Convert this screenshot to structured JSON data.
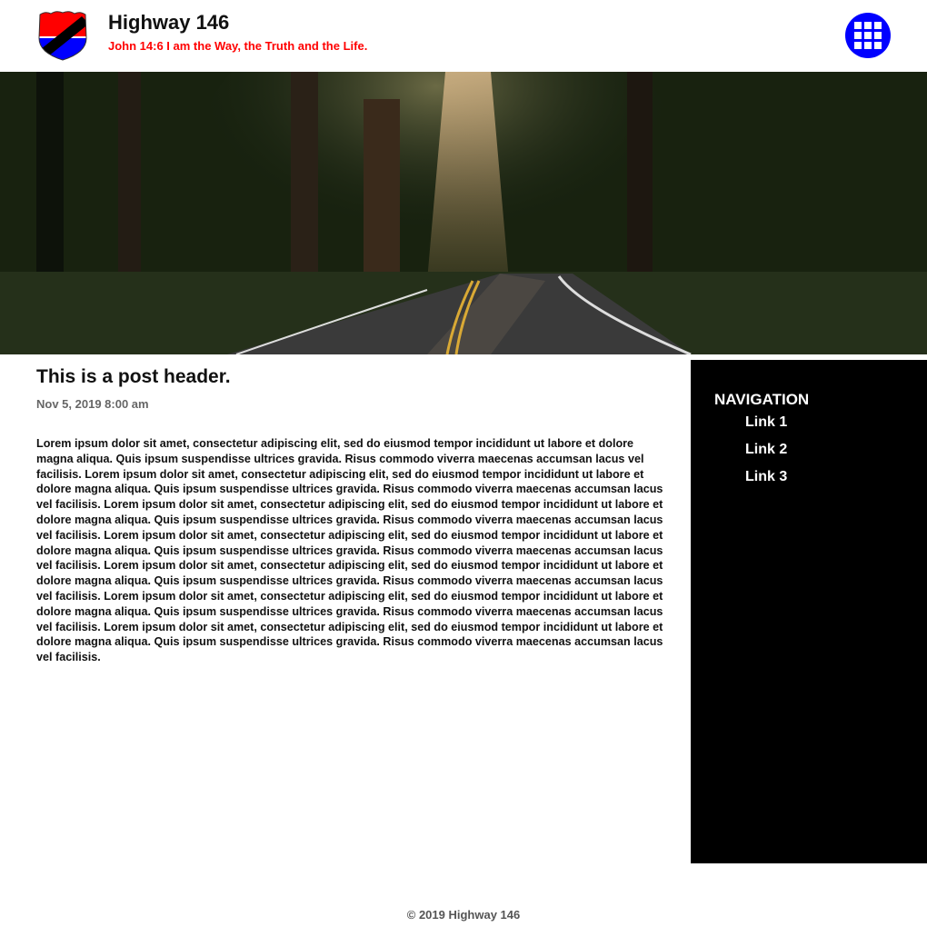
{
  "header": {
    "title": "Highway 146",
    "tagline": "John 14:6 I am the Way, the Truth and the Life.",
    "logo_icon": "highway-shield-icon",
    "menu_icon": "grid-menu-icon",
    "accent": "#0000ff",
    "tagline_color": "#ff0000"
  },
  "post": {
    "title": "This is a post header.",
    "date": "Nov 5, 2019 8:00 am",
    "body": "Lorem ipsum dolor sit amet, consectetur adipiscing elit, sed do eiusmod tempor incididunt ut labore et dolore magna aliqua. Quis ipsum suspendisse ultrices gravida. Risus commodo viverra maecenas accumsan lacus vel facilisis. Lorem ipsum dolor sit amet, consectetur adipiscing elit, sed do eiusmod tempor incididunt ut labore et dolore magna aliqua. Quis ipsum suspendisse ultrices gravida. Risus commodo viverra maecenas accumsan lacus vel facilisis. Lorem ipsum dolor sit amet, consectetur adipiscing elit, sed do eiusmod tempor incididunt ut labore et dolore magna aliqua. Quis ipsum suspendisse ultrices gravida. Risus commodo viverra maecenas accumsan lacus vel facilisis. Lorem ipsum dolor sit amet, consectetur adipiscing elit, sed do eiusmod tempor incididunt ut labore et dolore magna aliqua. Quis ipsum suspendisse ultrices gravida. Risus commodo viverra maecenas accumsan lacus vel facilisis. Lorem ipsum dolor sit amet, consectetur adipiscing elit, sed do eiusmod tempor incididunt ut labore et dolore magna aliqua. Quis ipsum suspendisse ultrices gravida. Risus commodo viverra maecenas accumsan lacus vel facilisis. Lorem ipsum dolor sit amet, consectetur adipiscing elit, sed do eiusmod tempor incididunt ut labore et dolore magna aliqua. Quis ipsum suspendisse ultrices gravida. Risus commodo viverra maecenas accumsan lacus vel facilisis. Lorem ipsum dolor sit amet, consectetur adipiscing elit, sed do eiusmod tempor incididunt ut labore et dolore magna aliqua. Quis ipsum suspendisse ultrices gravida. Risus commodo viverra maecenas accumsan lacus vel facilisis."
  },
  "sidebar": {
    "title": "NAVIGATION",
    "links": [
      {
        "label": "Link 1"
      },
      {
        "label": "Link 2"
      },
      {
        "label": "Link 3"
      }
    ]
  },
  "footer": {
    "text": "© 2019 Highway 146"
  }
}
